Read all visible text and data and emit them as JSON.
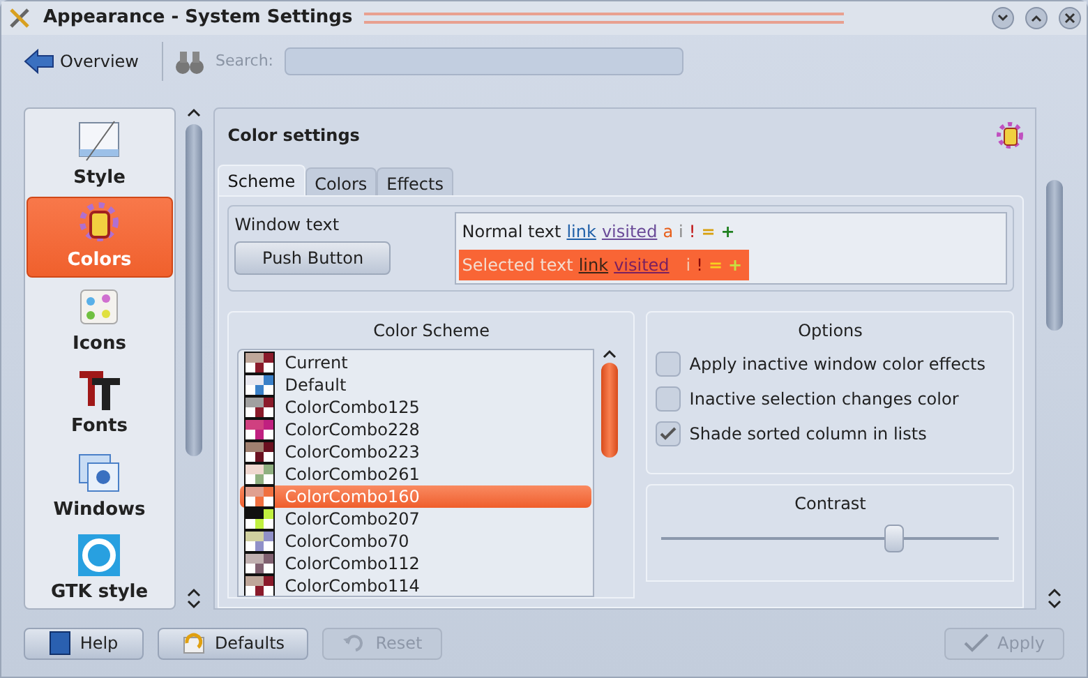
{
  "window": {
    "title": "Appearance - System Settings"
  },
  "toolbar": {
    "overview": "Overview",
    "search_label": "Search:"
  },
  "sidebar": {
    "items": [
      {
        "label": "Style",
        "selected": false
      },
      {
        "label": "Colors",
        "selected": true
      },
      {
        "label": "Icons",
        "selected": false
      },
      {
        "label": "Fonts",
        "selected": false
      },
      {
        "label": "Windows",
        "selected": false
      },
      {
        "label": "GTK style",
        "selected": false
      }
    ]
  },
  "page": {
    "title": "Color settings",
    "tabs": [
      {
        "label": "Scheme",
        "selected": true
      },
      {
        "label": "Colors",
        "selected": false
      },
      {
        "label": "Effects",
        "selected": false
      }
    ],
    "preview": {
      "window_text": "Window text",
      "push_button": "Push Button",
      "normal": [
        {
          "kind": "text",
          "text": "Normal text"
        },
        {
          "kind": "link",
          "text": "link"
        },
        {
          "kind": "visited",
          "text": "visited"
        },
        {
          "kind": "active",
          "text": "a"
        },
        {
          "kind": "inactive",
          "text": "i"
        },
        {
          "kind": "negative",
          "text": "!"
        },
        {
          "kind": "neutral",
          "text": "="
        },
        {
          "kind": "positive",
          "text": "+"
        }
      ],
      "selected": [
        {
          "kind": "text",
          "text": "Selected text"
        },
        {
          "kind": "link",
          "text": "link"
        },
        {
          "kind": "visited",
          "text": "visited"
        },
        {
          "kind": "inactive",
          "text": "i"
        },
        {
          "kind": "negative",
          "text": "!"
        },
        {
          "kind": "neutral",
          "text": "="
        },
        {
          "kind": "positive",
          "text": "+"
        }
      ]
    },
    "color_scheme": {
      "title": "Color Scheme",
      "items": [
        {
          "label": "Current",
          "selected": false
        },
        {
          "label": "Default",
          "selected": false
        },
        {
          "label": "ColorCombo125",
          "selected": false
        },
        {
          "label": "ColorCombo228",
          "selected": false
        },
        {
          "label": "ColorCombo223",
          "selected": false
        },
        {
          "label": "ColorCombo261",
          "selected": false
        },
        {
          "label": "ColorCombo160",
          "selected": true
        },
        {
          "label": "ColorCombo207",
          "selected": false
        },
        {
          "label": "ColorCombo70",
          "selected": false
        },
        {
          "label": "ColorCombo112",
          "selected": false
        },
        {
          "label": "ColorCombo114",
          "selected": false
        }
      ]
    },
    "options": {
      "title": "Options",
      "items": [
        {
          "label": "Apply inactive window color effects",
          "checked": false
        },
        {
          "label": "Inactive selection changes color",
          "checked": false
        },
        {
          "label": "Shade sorted column in lists",
          "checked": true
        }
      ]
    },
    "contrast": {
      "title": "Contrast",
      "level": 0.69
    }
  },
  "buttons": [
    {
      "kind": "help",
      "label": "Help",
      "disabled": false
    },
    {
      "kind": "defaults",
      "label": "Defaults",
      "disabled": false
    },
    {
      "kind": "reset",
      "label": "Reset",
      "disabled": true
    },
    {
      "kind": "apply",
      "label": "Apply",
      "disabled": true
    }
  ]
}
